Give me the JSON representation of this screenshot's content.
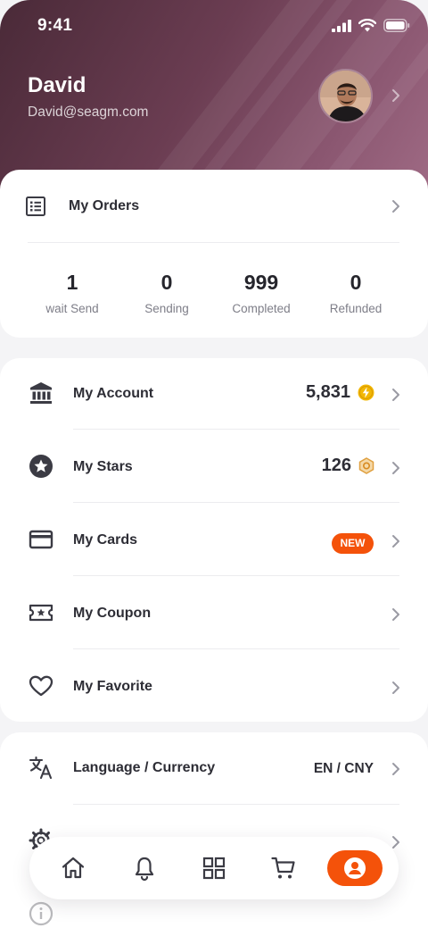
{
  "status_bar": {
    "time": "9:41"
  },
  "profile": {
    "name": "David",
    "email": "David@seagm.com"
  },
  "orders": {
    "label": "My Orders",
    "stats": [
      {
        "value": "1",
        "label": "wait Send"
      },
      {
        "value": "0",
        "label": "Sending"
      },
      {
        "value": "999",
        "label": "Completed"
      },
      {
        "value": "0",
        "label": "Refunded"
      }
    ]
  },
  "menu": {
    "account": {
      "label": "My Account",
      "value": "5,831"
    },
    "stars": {
      "label": "My Stars",
      "value": "126"
    },
    "cards": {
      "label": "My Cards",
      "badge": "NEW"
    },
    "coupon": {
      "label": "My Coupon"
    },
    "favorite": {
      "label": "My Favorite"
    }
  },
  "settings": {
    "language": {
      "label": "Language / Currency",
      "value": "EN / CNY"
    }
  },
  "tabbar": {
    "items": [
      "home-icon",
      "bell-icon",
      "grid-icon",
      "cart-icon",
      "profile-icon"
    ],
    "active": "profile-icon"
  },
  "colors": {
    "accent": "#f4520a",
    "coin": "#f2b705",
    "star_badge": "#e0a040"
  }
}
